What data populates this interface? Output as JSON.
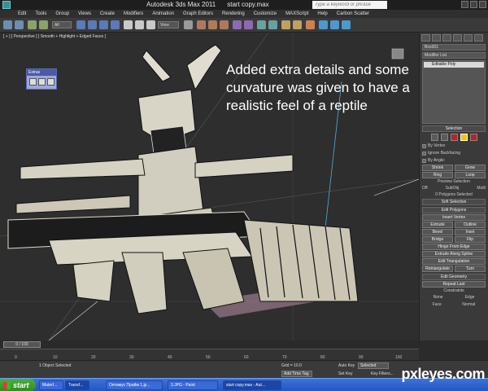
{
  "window": {
    "app_title": "Autodesk 3ds Max  2011",
    "file_title": "start copy.max",
    "search_placeholder": "Type a keyword or phrase"
  },
  "menubar": [
    "Edit",
    "Tools",
    "Group",
    "Views",
    "Create",
    "Modifiers",
    "Animation",
    "Graph Editors",
    "Rendering",
    "Customize",
    "MAXScript",
    "Help",
    "Carbon Scatter"
  ],
  "toolbar": {
    "selection_filter": "All",
    "reference_coord": "View"
  },
  "viewport": {
    "label": "[ + ] [ Perspective ] [ Smooth + Highlight + Edged Faces ]",
    "annotation": "Added extra details and some curvature was given to have a realistic feel of a reptile",
    "extras_panel_title": "Extras"
  },
  "command_panel": {
    "object_name": "Box001",
    "modifier_list": "Modifier List",
    "stack_item": "Editable Poly",
    "selection_rollout": "Selection",
    "by_vertex": "By Vertex",
    "ignore_backfacing": "Ignore Backfacing",
    "by_angle": "By Angle:",
    "shrink": "Shrink",
    "grow": "Grow",
    "ring": "Ring",
    "loop": "Loop",
    "preview_selection": "Preview Selection",
    "off": "Off",
    "subobj": "SubObj",
    "multi": "Multi",
    "polygons_selected": "0 Polygons Selected",
    "soft_selection": "Soft Selection",
    "edit_polygons": "Edit Polygons",
    "insert_vertex": "Insert Vertex",
    "extrude": "Extrude",
    "outline": "Outline",
    "bevel": "Bevel",
    "inset": "Inset",
    "bridge": "Bridge",
    "flip": "Flip",
    "hinge_from_edge": "Hinge From Edge",
    "extrude_along_spline": "Extrude Along Spline",
    "edit_triangulation": "Edit Triangulation",
    "retriangulate": "Retriangulate",
    "turn": "Turn",
    "edit_geometry": "Edit Geometry",
    "repeat_last": "Repeat Last",
    "constraints": "Constraints",
    "none": "None",
    "edge": "Edge",
    "face": "Face",
    "normal": "Normal"
  },
  "timeline": {
    "slider": "0 / 100",
    "ticks": [
      "0",
      "10",
      "20",
      "30",
      "40",
      "50",
      "60",
      "70",
      "80",
      "90",
      "100"
    ]
  },
  "status": {
    "selected": "1 Object Selected",
    "grid": "Grid = 10.0",
    "auto_key": "Auto Key",
    "selected_mode": "Selected",
    "set_key": "Set Key",
    "key_filters": "Key Filters...",
    "add_time_tag": "Add Time Tag"
  },
  "taskbar": {
    "start": "start",
    "items": [
      "MaterI...",
      "Transf...",
      "Оптимус Прайм 1.jp...",
      "3.JPG - Paint",
      "start copy.max - Aut..."
    ]
  },
  "watermark": "pxleyes.com",
  "colors": {
    "viewport_bg": "#2e2e2e",
    "panel_bg": "#3a3a3a",
    "selection_active": "#f4c400",
    "taskbar_blue": "#2456c2",
    "start_green": "#3a9a2a"
  }
}
